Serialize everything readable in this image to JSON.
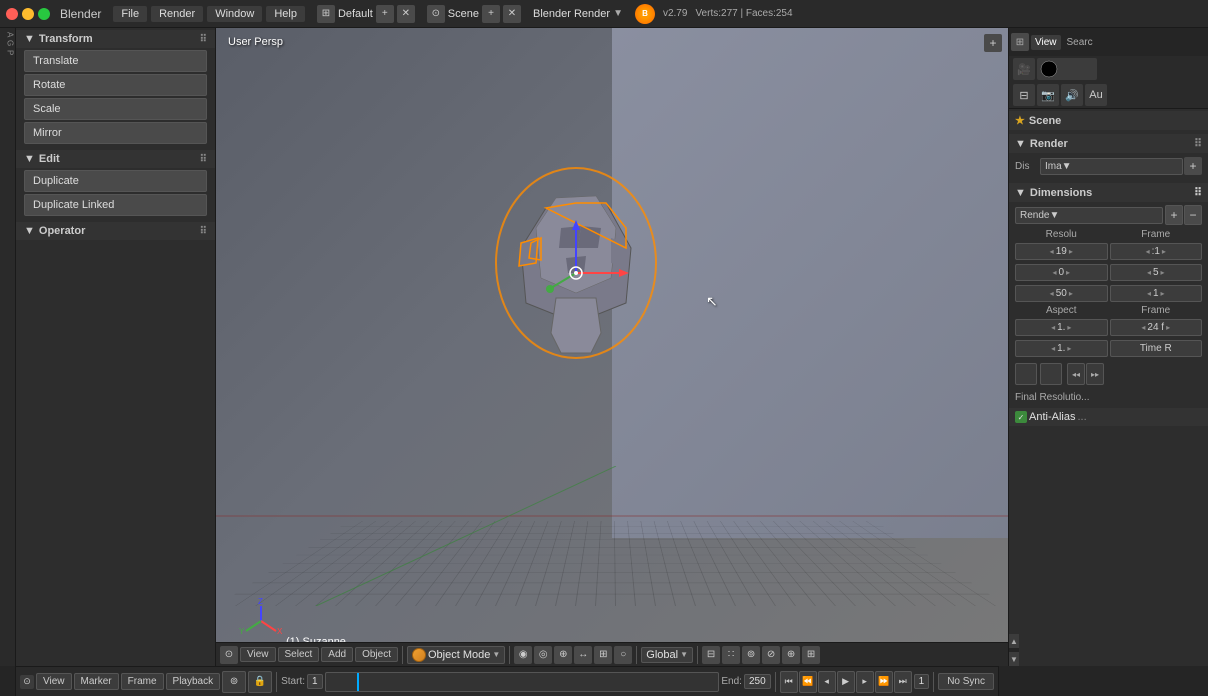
{
  "app": {
    "title": "Blender",
    "version": "v2.79",
    "stats": "Verts:277 | Faces:254"
  },
  "window_controls": {
    "close": "●",
    "minimize": "●",
    "maximize": "●"
  },
  "top_bar": {
    "layout": "Default",
    "scene": "Scene",
    "render_engine": "Blender Render"
  },
  "menus": {
    "file": "File",
    "render": "Render",
    "window": "Window",
    "help": "Help"
  },
  "left_panel": {
    "transform_section": "Transform",
    "edit_section": "Edit",
    "operator_section": "Operator",
    "buttons": {
      "translate": "Translate",
      "rotate": "Rotate",
      "scale": "Scale",
      "mirror": "Mirror",
      "duplicate": "Duplicate",
      "duplicate_linked": "Duplicate Linked"
    }
  },
  "viewport": {
    "label": "User Persp",
    "object_label": "(1) Suzanne",
    "mode": "Object Mode",
    "shading": "Global"
  },
  "viewport_bottom": {
    "view": "View",
    "select": "Select",
    "add": "Add",
    "object": "Object",
    "mode": "Object Mode",
    "transform": "Global"
  },
  "right_panel": {
    "scene_label": "Scene",
    "sections": {
      "render": "Render",
      "dimensions": "Dimensions",
      "final_res": "Final Resolutio..."
    },
    "render_modes": {
      "dis": "Dis",
      "ima": "Ima▼",
      "plus": "+"
    },
    "dimensions": {
      "preset": "Rende▼",
      "resolu_label": "Resolu",
      "frame_label": "Frame",
      "aspect_label": "Aspect",
      "frame_label2": "Frame",
      "row1": {
        "resolu1": "◂ 19 ▸",
        "frame1": "◂ :1 ▸"
      },
      "row2": {
        "resolu2": "◂ 0 ▸",
        "frame2": "◂ 5 ▸"
      },
      "row3": {
        "resolu3": "◂ 50 ▸",
        "frame3": "◂ 1 ▸"
      },
      "aspect1": "◂ 1. ▸",
      "aspect2": "◂ 1. ▸",
      "frame_rate": "24 f ▸",
      "time_remap": "Time R"
    }
  },
  "timeline": {
    "view": "View",
    "marker": "Marker",
    "frame": "Frame",
    "playback": "Playback",
    "start_label": "Start:",
    "start_val": "1",
    "end_label": "End:",
    "end_val": "250",
    "current": "1",
    "no_sync": "No Sync"
  },
  "icons": {
    "triangle_right": "▶",
    "triangle_down": "▼",
    "plus": "+",
    "minus": "−",
    "chevron_left": "◂",
    "chevron_right": "▸",
    "close": "✕",
    "check": "✓"
  }
}
